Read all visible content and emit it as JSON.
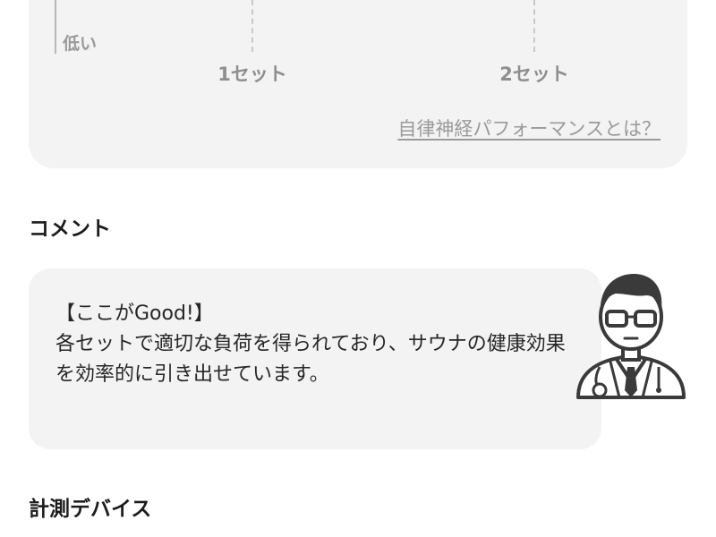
{
  "chart": {
    "y_low_label": "低い",
    "set_labels": [
      "1セット",
      "2セット"
    ],
    "help_link": "自律神経パフォーマンスとは？"
  },
  "comment": {
    "heading": "コメント",
    "headline": "【ここがGood!】",
    "body": "各セットで適切な負荷を得られており、サウナの健康効果を効率的に引き出せています。",
    "avatar_icon": "doctor-icon"
  },
  "device": {
    "heading": "計測デバイス"
  },
  "colors": {
    "card_background": "#f3f3f3",
    "muted_text": "#9a9a9a",
    "heading_text": "#1c1c1c"
  }
}
